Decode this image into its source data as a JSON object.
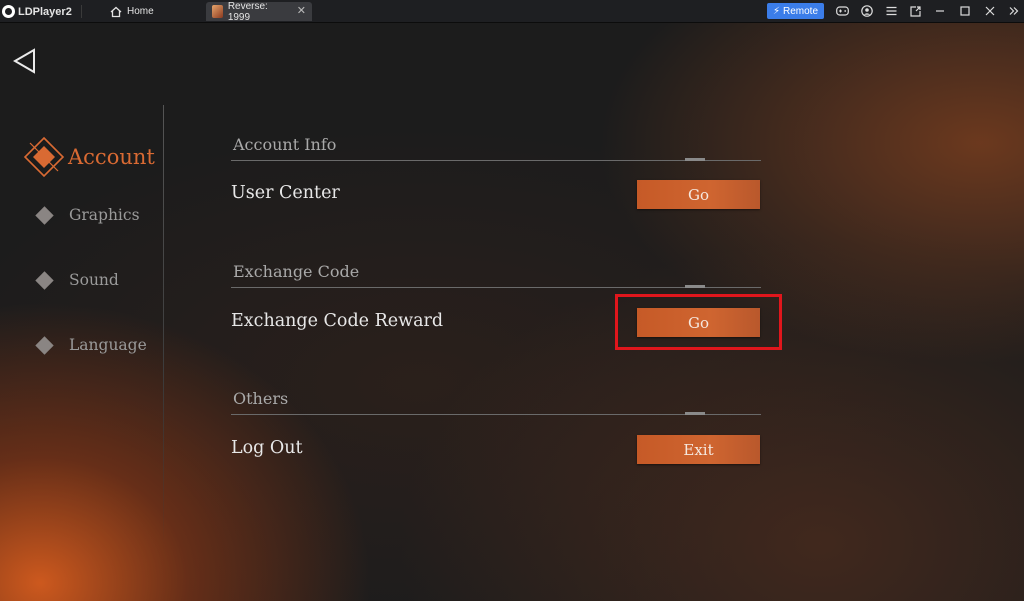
{
  "titlebar": {
    "brand": "LDPlayer2",
    "home_tab": "Home",
    "game_tab": "Reverse: 1999",
    "close_glyph": "✕",
    "remote_label": "Remote",
    "remote_glyph": "⚡",
    "icons": [
      "gamepad-icon",
      "account-icon",
      "menu-icon",
      "screen-share-icon",
      "minimize-icon",
      "maximize-icon",
      "close-icon",
      "double-chevron-icon"
    ]
  },
  "sidebar": {
    "items": [
      {
        "label": "Account",
        "active": true
      },
      {
        "label": "Graphics",
        "active": false
      },
      {
        "label": "Sound",
        "active": false
      },
      {
        "label": "Language",
        "active": false
      }
    ]
  },
  "sections": [
    {
      "title": "Account Info",
      "row_label": "User Center",
      "button_label": "Go"
    },
    {
      "title": "Exchange Code",
      "row_label": "Exchange Code Reward",
      "button_label": "Go"
    },
    {
      "title": "Others",
      "row_label": "Log Out",
      "button_label": "Exit"
    }
  ],
  "colors": {
    "accent": "#d96a33",
    "button": "#c65a27",
    "highlight": "#e0161c",
    "remote": "#3b7de9"
  }
}
